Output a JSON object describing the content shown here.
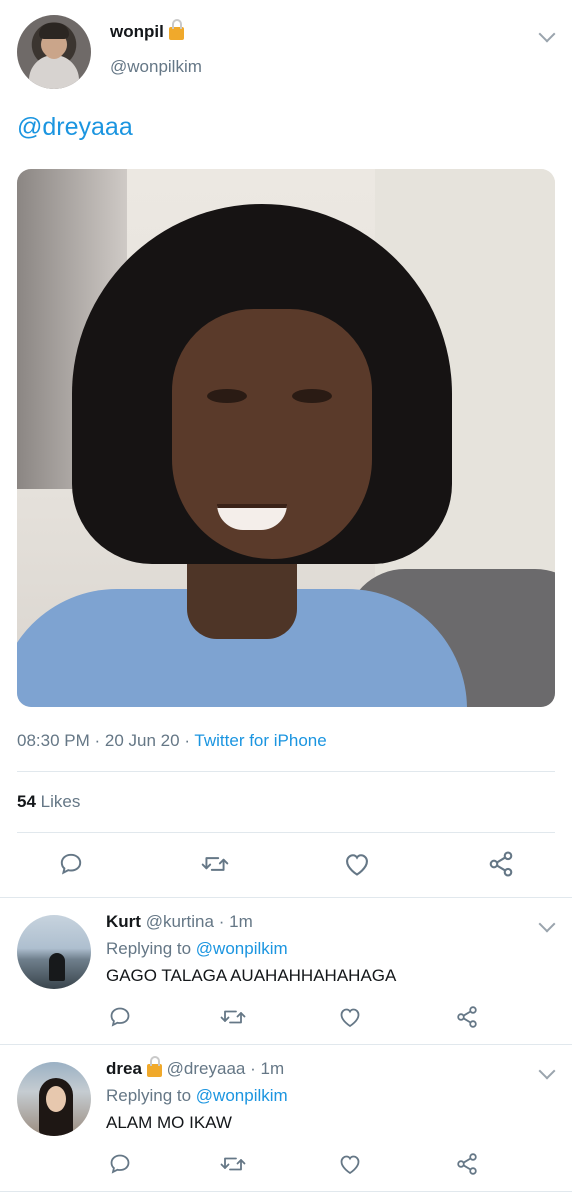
{
  "tweet": {
    "author_name": "wonpil",
    "author_handle": "@wonpilkim",
    "mention": "@dreyaaa",
    "time": "08:30 PM",
    "date": "20 Jun 20",
    "source": "Twitter for iPhone",
    "likes_count": "54",
    "likes_label": "Likes"
  },
  "icons": {
    "lock": "lock-icon",
    "reply": "reply-icon",
    "retweet": "retweet-icon",
    "like": "heart-icon",
    "share": "share-icon",
    "more": "chevron-down-icon"
  },
  "replies": [
    {
      "name": "Kurt",
      "handle": "@kurtina",
      "time": "1m",
      "replying_prefix": "Replying to",
      "replying_to": "@wonpilkim",
      "text": "GAGO TALAGA AUAHAHHAHAHAGA"
    },
    {
      "name": "drea",
      "handle": "@dreyaaa",
      "time": "1m",
      "replying_prefix": "Replying to",
      "replying_to": "@wonpilkim",
      "text": "ALAM MO IKAW"
    }
  ],
  "colors": {
    "link": "#1b95e0",
    "secondary_text": "#657786",
    "primary_text": "#14171a",
    "divider": "#e1e8ed",
    "icon": "#657786"
  }
}
